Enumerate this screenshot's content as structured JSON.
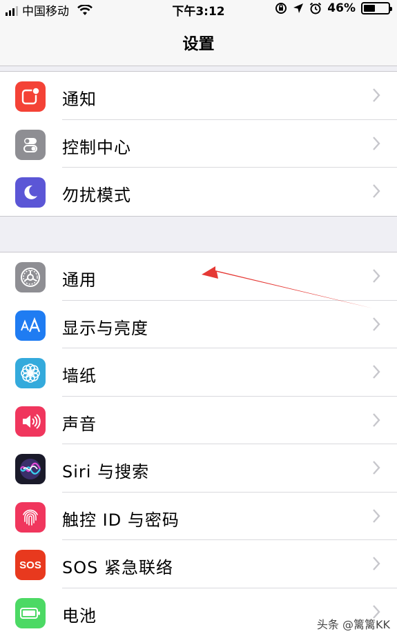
{
  "status_bar": {
    "carrier": "中国移动",
    "time": "下午3:12",
    "battery_percent": "46%",
    "battery_level": 0.46
  },
  "nav": {
    "title": "设置"
  },
  "groups": [
    {
      "items": [
        {
          "label": "通知",
          "icon": "notifications-icon",
          "color": "#f44236"
        },
        {
          "label": "控制中心",
          "icon": "control-center-icon",
          "color": "#8e8e93"
        },
        {
          "label": "勿扰模式",
          "icon": "moon-icon",
          "color": "#5b56d6"
        }
      ]
    },
    {
      "items": [
        {
          "label": "通用",
          "icon": "gear-icon",
          "color": "#8e8e93"
        },
        {
          "label": "显示与亮度",
          "icon": "display-brightness-icon",
          "color": "#1f7cf2"
        },
        {
          "label": "墙纸",
          "icon": "wallpaper-icon",
          "color": "#34aadc"
        },
        {
          "label": "声音",
          "icon": "speaker-icon",
          "color": "#f0365d"
        },
        {
          "label": "Siri 与搜索",
          "icon": "siri-icon",
          "color": "#222233"
        },
        {
          "label": "触控 ID 与密码",
          "icon": "fingerprint-icon",
          "color": "#f0365d"
        },
        {
          "label": "SOS 紧急联络",
          "icon": "sos-icon",
          "color": "#e8391e"
        },
        {
          "label": "电池",
          "icon": "battery-icon",
          "color": "#4cd964"
        }
      ]
    }
  ],
  "sos_icon_text": "SOS",
  "watermark": "头条 @篱篱KK",
  "annotation_arrow_color": "#e53935"
}
